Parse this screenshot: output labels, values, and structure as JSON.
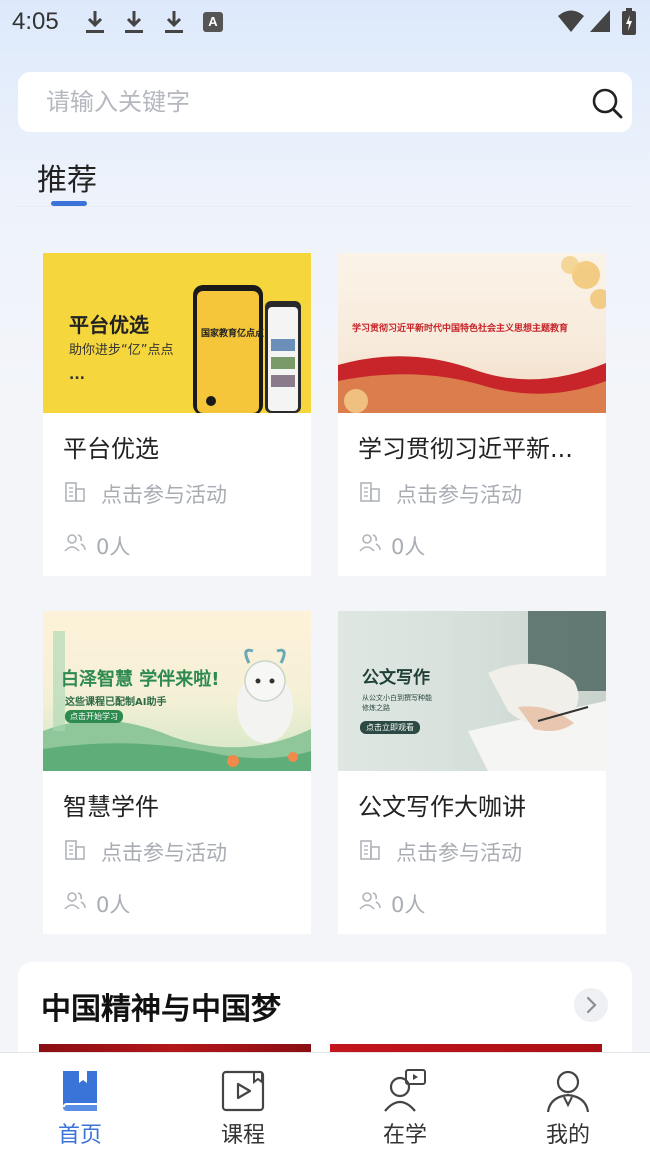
{
  "status_bar": {
    "time": "4:05",
    "a_badge": "A"
  },
  "search": {
    "placeholder": "请输入关键字"
  },
  "tabs": [
    {
      "label": "推荐",
      "active": true
    }
  ],
  "cards": [
    {
      "title": "平台优选",
      "action": "点击参与活动",
      "count": "0人",
      "thumb": {
        "headline": "平台优选",
        "subline": "助你进步“亿”点点",
        "dots": "...",
        "phone_text": "国家教育亿点点"
      }
    },
    {
      "title": "学习贯彻习近平新...",
      "action": "点击参与活动",
      "count": "0人",
      "thumb": {
        "headline": "学习贯彻习近平新时代中国特色社会主义思想主题教育"
      }
    },
    {
      "title": "智慧学件",
      "action": "点击参与活动",
      "count": "0人",
      "thumb": {
        "headline": "白泽智慧 学伴来啦!",
        "subline": "这些课程已配制AI助手",
        "button": "点击开始学习"
      }
    },
    {
      "title": "公文写作大咖讲",
      "action": "点击参与活动",
      "count": "0人",
      "thumb": {
        "headline": "公文写作",
        "subline": "从公文小白到撰写种能",
        "subline2": "修炼之路",
        "button": "点击立即观看"
      }
    }
  ],
  "topic": {
    "title": "中国精神与中国梦"
  },
  "nav": [
    {
      "label": "首页",
      "icon": "book-icon",
      "active": true
    },
    {
      "label": "课程",
      "icon": "video-course-icon",
      "active": false
    },
    {
      "label": "在学",
      "icon": "learner-icon",
      "active": false
    },
    {
      "label": "我的",
      "icon": "profile-icon",
      "active": false
    }
  ],
  "colors": {
    "accent": "#3b74d8",
    "muted": "#a8acb3",
    "card_yellow": "#f5d63d"
  }
}
